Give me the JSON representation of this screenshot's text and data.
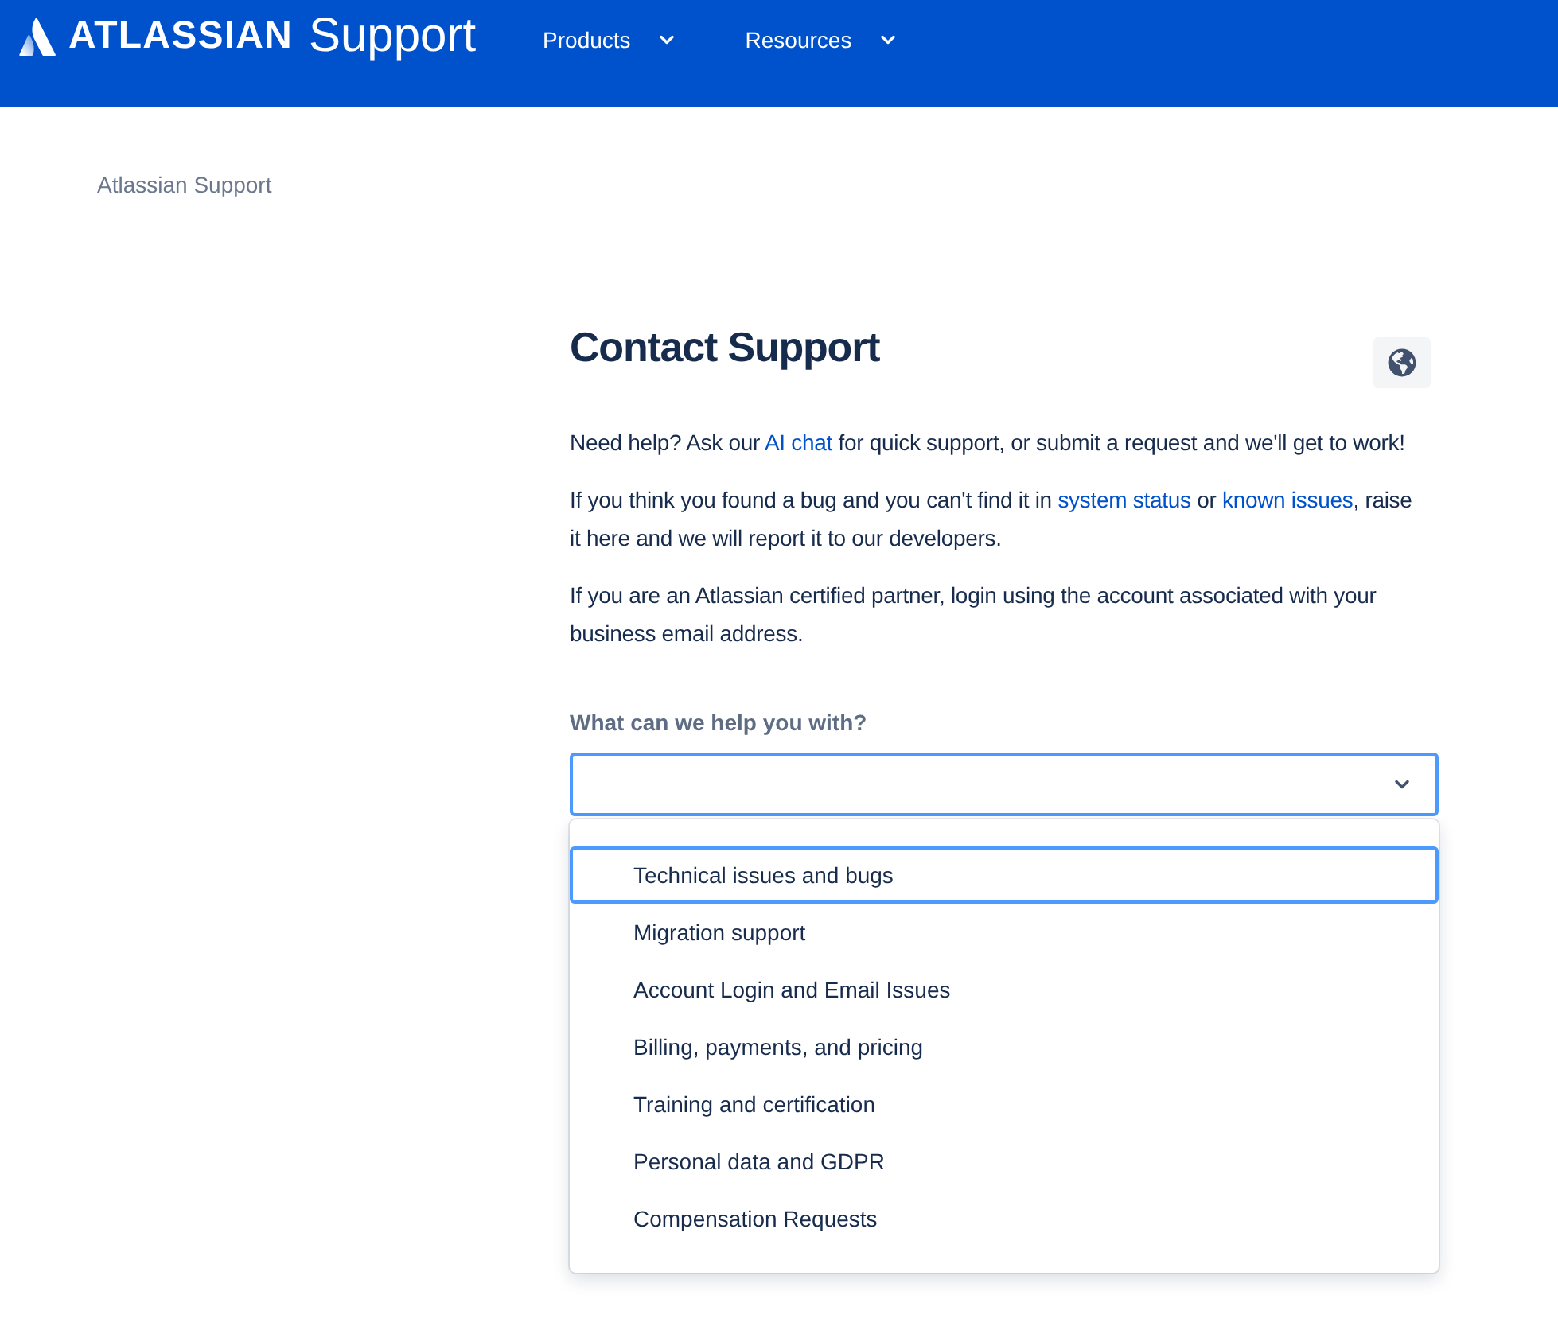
{
  "header": {
    "logo": {
      "brand": "ATLASSIAN",
      "product": "Support"
    },
    "nav": [
      {
        "label": "Products"
      },
      {
        "label": "Resources"
      }
    ]
  },
  "breadcrumb": [
    {
      "label": "Atlassian Support"
    }
  ],
  "page": {
    "title": "Contact Support",
    "paragraphs": [
      [
        {
          "kind": "text",
          "text": "Need help? Ask our "
        },
        {
          "kind": "link",
          "text": "AI chat"
        },
        {
          "kind": "text",
          "text": " for quick support, or submit a request and we'll get to work!"
        }
      ],
      [
        {
          "kind": "text",
          "text": "If you think you found a bug and you can't find it in "
        },
        {
          "kind": "link",
          "text": "system status"
        },
        {
          "kind": "text",
          "text": " or "
        },
        {
          "kind": "link",
          "text": "known issues"
        },
        {
          "kind": "text",
          "text": ", raise it here and we will report it to our developers."
        }
      ],
      [
        {
          "kind": "text",
          "text": "If you are an Atlassian certified partner, login using the account associated with your business email address."
        }
      ]
    ]
  },
  "form": {
    "label": "What can we help you with?",
    "select": {
      "expanded": true,
      "options": [
        {
          "label": "Technical issues and bugs",
          "highlighted": true
        },
        {
          "label": "Migration support",
          "highlighted": false
        },
        {
          "label": "Account Login and Email Issues",
          "highlighted": false
        },
        {
          "label": "Billing, payments, and pricing",
          "highlighted": false
        },
        {
          "label": "Training and certification",
          "highlighted": false
        },
        {
          "label": "Personal data and GDPR",
          "highlighted": false
        },
        {
          "label": "Compensation Requests",
          "highlighted": false
        }
      ]
    }
  }
}
